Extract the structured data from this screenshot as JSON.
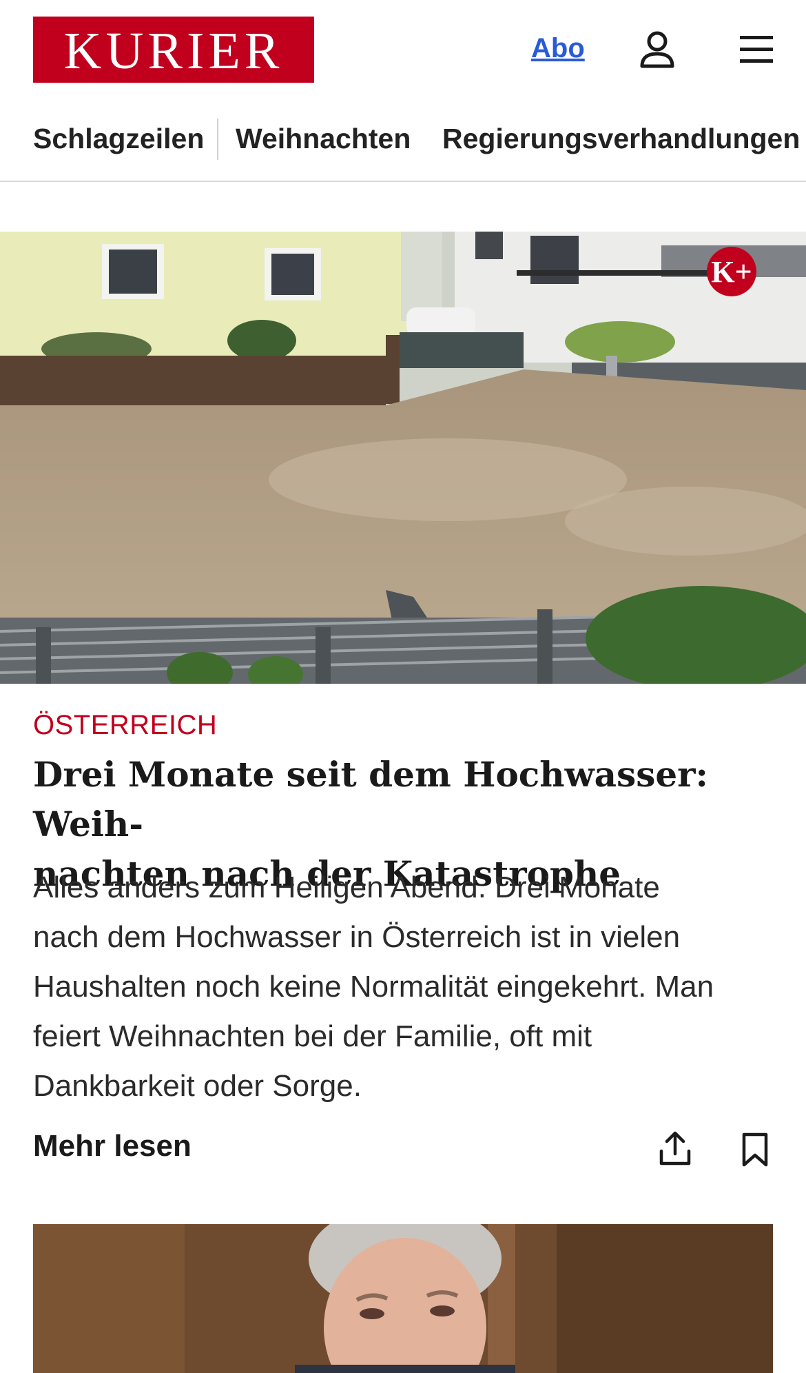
{
  "header": {
    "logo_text": "KURIER",
    "abo_label": "Abo",
    "brand_color": "#c1001e",
    "user_icon": "user-icon",
    "menu_icon": "hamburger-menu-icon"
  },
  "nav": {
    "items": [
      "Schlagzeilen",
      "Weihnachten",
      "Regierungsverhandlungen"
    ]
  },
  "article": {
    "badge": "K+",
    "category": "ÖSTERREICH",
    "headline_line1": "Drei Monate seit dem Hochwasser: Weih-",
    "headline_line2": "nachten nach der Katastrophe",
    "teaser_lines": [
      "Alles anders zum Heiligen Abend. Drei Monate",
      "nach dem Hochwasser in Österreich ist in vielen",
      "Haushalten noch keine Normalität eingekehrt. Man",
      "feiert Weihnachten bei der Familie, oft mit",
      "Dankbarkeit oder Sorge."
    ],
    "more_label": "Mehr lesen",
    "share_icon": "share-icon",
    "bookmark_icon": "bookmark-icon"
  }
}
